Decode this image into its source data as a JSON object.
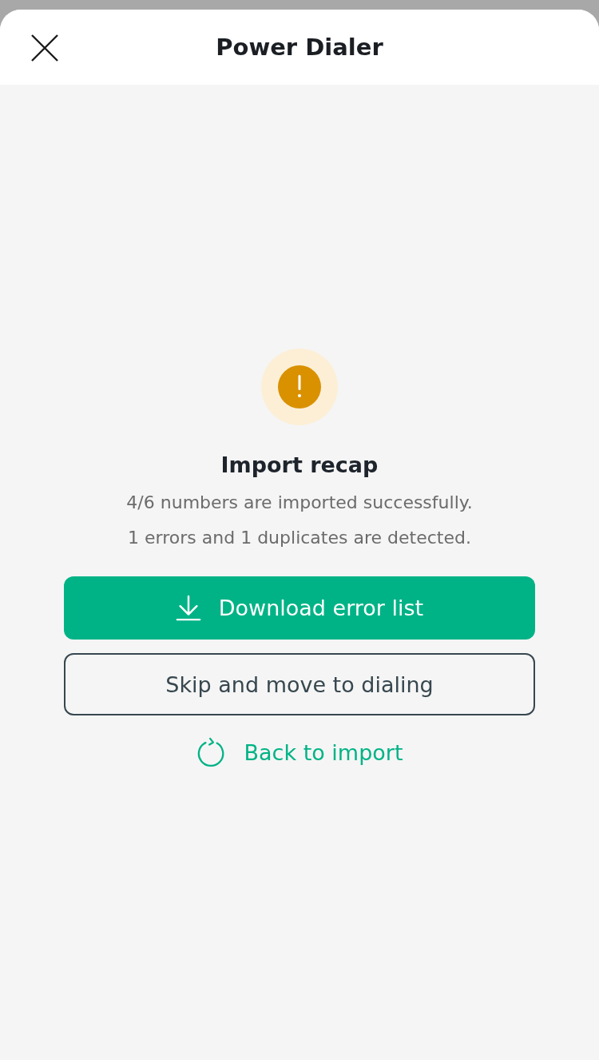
{
  "header": {
    "title": "Power Dialer"
  },
  "recap": {
    "title": "Import recap",
    "lines": [
      "4/6 numbers are imported successfully.",
      "1 errors and 1 duplicates are detected."
    ]
  },
  "buttons": [
    {
      "kind": "primary",
      "label": "Download error list"
    },
    {
      "kind": "outline",
      "label": "Skip and move to dialing"
    },
    {
      "kind": "link",
      "label": "Back to import"
    }
  ]
}
